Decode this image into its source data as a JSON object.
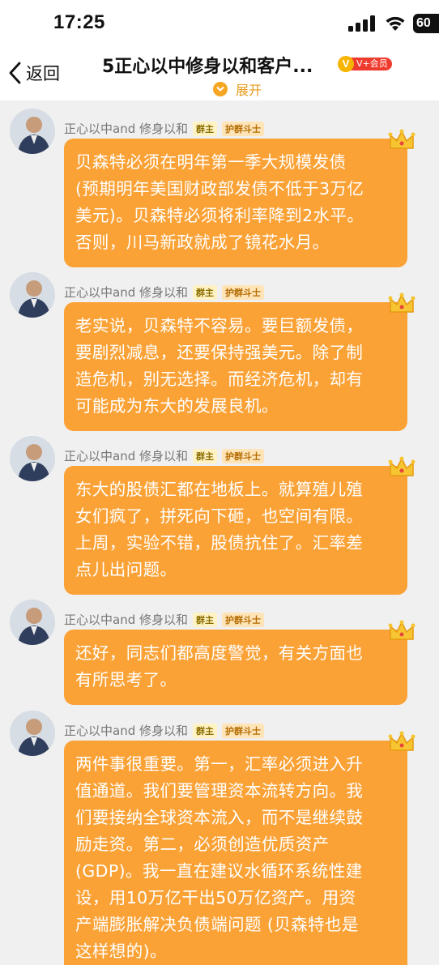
{
  "status_bar": {
    "time": "17:25",
    "battery": "60",
    "icons": [
      "signal-icon",
      "wifi-icon",
      "battery-icon"
    ]
  },
  "nav": {
    "back_label": "返回",
    "title": "5正心以中修身以和客户...",
    "vip_badge_letter": "V",
    "vip_badge_text": "V+会员",
    "expand_label": "展开"
  },
  "colors": {
    "bubble": "#fba236",
    "accent": "#f5a623",
    "vip_red": "#ef3b2d"
  },
  "messages": [
    {
      "sender": "正心以中and 修身以和",
      "badges": [
        "群主",
        "护群斗士"
      ],
      "text": "贝森特必须在明年第一季大规模发债\n(预期明年美国财政部发债不低于3万亿\n美元)。贝森特必须将利率降到2水平。\n否则，川马新政就成了镜花水月。"
    },
    {
      "sender": "正心以中and 修身以和",
      "badges": [
        "群主",
        "护群斗士"
      ],
      "text": "老实说，贝森特不容易。要巨额发债，\n要剧烈减息，还要保持强美元。除了制\n造危机，别无选择。而经济危机，却有\n可能成为东大的发展良机。"
    },
    {
      "sender": "正心以中and 修身以和",
      "badges": [
        "群主",
        "护群斗士"
      ],
      "text": "东大的股债汇都在地板上。就算殖儿殖\n女们疯了，拼死向下砸，也空间有限。\n上周，实验不错，股债抗住了。汇率差\n点儿出问题。"
    },
    {
      "sender": "正心以中and 修身以和",
      "badges": [
        "群主",
        "护群斗士"
      ],
      "text": "还好，同志们都高度警觉，有关方面也\n有所思考了。"
    },
    {
      "sender": "正心以中and 修身以和",
      "badges": [
        "群主",
        "护群斗士"
      ],
      "text": "两件事很重要。第一，汇率必须进入升\n值通道。我们要管理资本流转方向。我\n们要接纳全球资本流入，而不是继续鼓\n励走资。第二，必须创造优质资产\n(GDP)。我一直在建议水循环系统性建\n设，用10万亿干出50万亿资产。用资\n产端膨胀解决负债端问题 (贝森特也是\n这样想的)。"
    }
  ]
}
